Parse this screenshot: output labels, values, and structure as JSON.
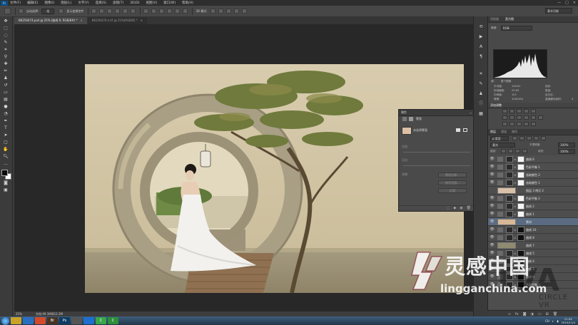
{
  "menubar": {
    "app_logo": "Ps",
    "items": [
      "文件(F)",
      "编辑(E)",
      "图像(I)",
      "图层(L)",
      "文字(Y)",
      "选择(S)",
      "滤镜(T)",
      "3D(D)",
      "视图(V)",
      "窗口(W)",
      "帮助(H)"
    ],
    "window_controls": [
      "—",
      "□",
      "×"
    ]
  },
  "options": {
    "auto_select_label": "自动选择:",
    "auto_select_value": "组",
    "show_transform_label": "显示变换控件",
    "mode_label": "3D 模式:",
    "workspace": "基本功能"
  },
  "tabs": [
    {
      "label": "BK256474.psd @ 25% (曲线 9, RGB/8#) *",
      "active": true
    },
    {
      "label": "BK256474-z.tif @ 25%(RGB/8) *",
      "active": false
    }
  ],
  "status": {
    "zoom": "25%",
    "doc": "文档:49.1M/812.2M"
  },
  "properties": {
    "title": "属性",
    "mode": "蒙版",
    "mask_type": "未选择蒙版",
    "density_label": "浓度:",
    "feather_label": "羽化:",
    "refine_label": "调整:",
    "buttons": [
      "蒙版边缘...",
      "颜色范围...",
      "反相"
    ]
  },
  "navigator": {
    "tabs": [
      "导航器",
      "直方图"
    ],
    "channel_label": "通道:",
    "channel_value": "RGB",
    "source_label": "源:",
    "source_value": "整个图像",
    "stats": [
      {
        "k": "平均值:",
        "v": "108.61"
      },
      {
        "k": "标准偏差:",
        "v": "29.83"
      },
      {
        "k": "中间值:",
        "v": "101"
      },
      {
        "k": "像素:",
        "v": "3262464"
      },
      {
        "k": "色阶:",
        "v": ""
      },
      {
        "k": "数量:",
        "v": ""
      },
      {
        "k": "百分位:",
        "v": ""
      },
      {
        "k": "高速缓存级别:",
        "v": "4"
      }
    ]
  },
  "adjustments": {
    "title": "添加调整"
  },
  "layers": {
    "tabs": [
      "图层",
      "通道",
      "路径"
    ],
    "kind_label": "ρ 类型",
    "blend_mode": "柔光",
    "opacity_label": "不透明度:",
    "opacity": "100%",
    "lock_label": "锁定:",
    "fill_label": "填充:",
    "fill": "100%",
    "rows": [
      {
        "name": "曲线 6",
        "visible": true,
        "mask": "white",
        "swatch": "",
        "selected": false
      },
      {
        "name": "色彩平衡 1",
        "visible": true,
        "mask": "white",
        "swatch": "",
        "selected": false
      },
      {
        "name": "选取颜色 2",
        "visible": true,
        "mask": "white",
        "swatch": "",
        "selected": false
      },
      {
        "name": "选取颜色 1",
        "visible": true,
        "mask": "white",
        "swatch": "",
        "selected": false
      },
      {
        "name": "图层 3 拷贝 2",
        "visible": false,
        "mask": "none",
        "swatch": "#d9c0a8",
        "selected": false
      },
      {
        "name": "色彩平衡 2",
        "visible": true,
        "mask": "white",
        "swatch": "",
        "selected": false
      },
      {
        "name": "曲线 2",
        "visible": true,
        "mask": "white",
        "swatch": "",
        "selected": false
      },
      {
        "name": "曲线 1",
        "visible": true,
        "mask": "white",
        "swatch": "",
        "selected": false
      },
      {
        "name": "素材",
        "visible": true,
        "mask": "none",
        "swatch": "#d6b896",
        "selected": true
      },
      {
        "name": "曲线 10",
        "visible": true,
        "mask": "black",
        "swatch": "",
        "selected": false
      },
      {
        "name": "曲线 8",
        "visible": true,
        "mask": "black",
        "swatch": "",
        "selected": false
      },
      {
        "name": "曲线 7",
        "visible": true,
        "mask": "none",
        "swatch": "#8f8a70",
        "selected": false
      },
      {
        "name": "曲线 5",
        "visible": true,
        "mask": "black",
        "swatch": "",
        "selected": false
      },
      {
        "name": "曲线 4",
        "visible": true,
        "mask": "black",
        "swatch": "",
        "selected": false
      },
      {
        "name": "曲线 3",
        "visible": true,
        "mask": "black",
        "swatch": "",
        "selected": false
      },
      {
        "name": "曲线 9",
        "visible": true,
        "mask": "black",
        "swatch": "",
        "selected": false
      },
      {
        "name": "色彩平衡 4",
        "visible": true,
        "mask": "black",
        "swatch": "",
        "selected": false
      }
    ]
  },
  "watermark": {
    "cn": "灵感中国",
    "url": "lingganchina.com",
    "bg_text": "LVA",
    "bg_sub": "CIRCLE VR"
  },
  "taskbar": {
    "apps": [
      {
        "label": "",
        "color": "#c9a227"
      },
      {
        "label": "",
        "color": "#2a6fbf"
      },
      {
        "label": "",
        "color": "#d54a2b"
      },
      {
        "label": "Br",
        "color": "#4a3320"
      },
      {
        "label": "Ps",
        "color": "#0f3a63"
      },
      {
        "label": "",
        "color": "#555555"
      },
      {
        "label": "",
        "color": "#1e6fcf"
      },
      {
        "label": "C",
        "color": "#3aa64a"
      },
      {
        "label": "C",
        "color": "#2d8f3c"
      }
    ],
    "tray_lang": "CH",
    "time": "11:54",
    "date": "2015/11/4"
  },
  "colors": {
    "fg": "#0a0a0a",
    "bg": "#ffffff",
    "accent_selected": "#5b6c82"
  }
}
